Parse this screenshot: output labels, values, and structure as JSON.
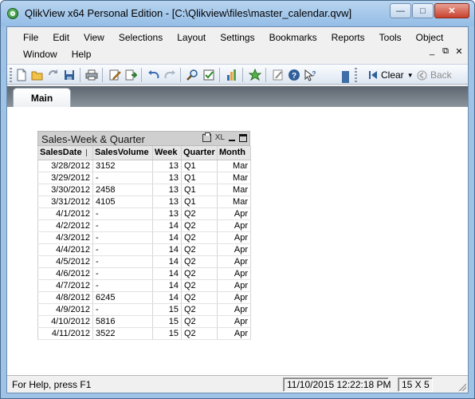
{
  "window": {
    "title": "QlikView x64 Personal Edition - [C:\\Qlikview\\files\\master_calendar.qvw]",
    "controls": {
      "minimize": "—",
      "maximize": "□",
      "close": "✕"
    }
  },
  "menu": {
    "row1": [
      "File",
      "Edit",
      "View",
      "Selections",
      "Layout",
      "Settings",
      "Bookmarks",
      "Reports",
      "Tools",
      "Object"
    ],
    "row2": [
      "Window",
      "Help"
    ],
    "mdi_controls": [
      "_",
      "⧉",
      "✕"
    ]
  },
  "toolbar": {
    "icons": [
      "new-icon",
      "open-icon",
      "reload-icon",
      "save-icon",
      "print-icon",
      "edit-script-icon",
      "reload-data-icon",
      "undo-icon",
      "redo-icon",
      "search-icon",
      "selections-icon",
      "chart-icon",
      "bookmark-star-icon",
      "edit-icon",
      "help-icon",
      "whats-this-icon"
    ],
    "clear_label": "Clear",
    "back_label": "Back"
  },
  "tabs": [
    {
      "label": "Main",
      "active": true
    }
  ],
  "tablebox": {
    "title": "Sales-Week & Quarter",
    "caption_icons": [
      "print-icon",
      "xl-icon",
      "minimize-icon",
      "maximize-icon"
    ],
    "xl_label": "XL",
    "columns": [
      "SalesDate",
      "SalesVolume",
      "Week",
      "Quarter",
      "Month"
    ],
    "rows": [
      [
        "3/28/2012",
        "3152",
        "13",
        "Q1",
        "Mar"
      ],
      [
        "3/29/2012",
        "-",
        "13",
        "Q1",
        "Mar"
      ],
      [
        "3/30/2012",
        "2458",
        "13",
        "Q1",
        "Mar"
      ],
      [
        "3/31/2012",
        "4105",
        "13",
        "Q1",
        "Mar"
      ],
      [
        "4/1/2012",
        "-",
        "13",
        "Q2",
        "Apr"
      ],
      [
        "4/2/2012",
        "-",
        "14",
        "Q2",
        "Apr"
      ],
      [
        "4/3/2012",
        "-",
        "14",
        "Q2",
        "Apr"
      ],
      [
        "4/4/2012",
        "-",
        "14",
        "Q2",
        "Apr"
      ],
      [
        "4/5/2012",
        "-",
        "14",
        "Q2",
        "Apr"
      ],
      [
        "4/6/2012",
        "-",
        "14",
        "Q2",
        "Apr"
      ],
      [
        "4/7/2012",
        "-",
        "14",
        "Q2",
        "Apr"
      ],
      [
        "4/8/2012",
        "6245",
        "14",
        "Q2",
        "Apr"
      ],
      [
        "4/9/2012",
        "-",
        "15",
        "Q2",
        "Apr"
      ],
      [
        "4/10/2012",
        "5816",
        "15",
        "Q2",
        "Apr"
      ],
      [
        "4/11/2012",
        "3522",
        "15",
        "Q2",
        "Apr"
      ]
    ]
  },
  "status": {
    "help_text": "For Help, press F1",
    "timestamp": "11/10/2015 12:22:18 PM",
    "dimensions": "15 X 5"
  },
  "colors": {
    "title_bar": "#9ec3e6",
    "close_button": "#c8412d",
    "caption": "#cfcfcf",
    "tab_strip": "#6b737c"
  }
}
